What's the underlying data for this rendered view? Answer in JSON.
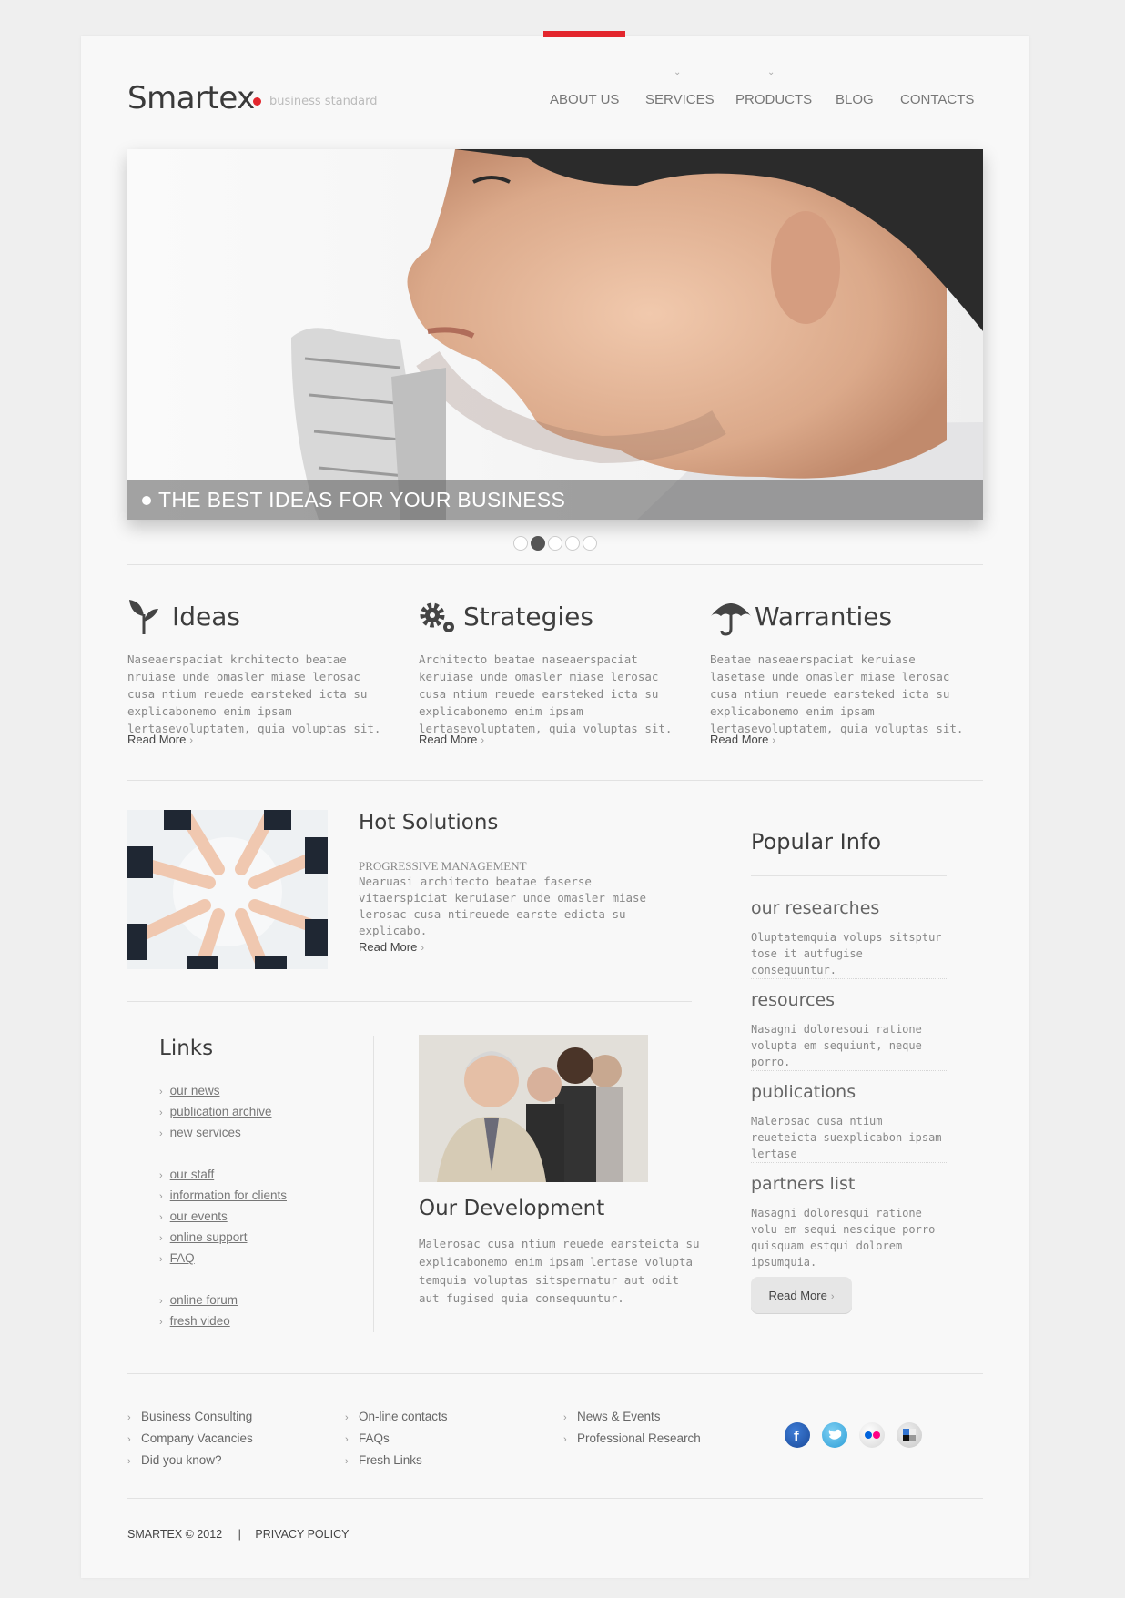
{
  "header": {
    "logo": "Smartex",
    "tagline": "business standard",
    "nav": [
      "ABOUT US",
      "SERVICES",
      "PRODUCTS",
      "BLOG",
      "CONTACTS"
    ]
  },
  "slider": {
    "caption": "THE BEST IDEAS FOR YOUR BUSINESS",
    "slides": 5,
    "active_slide": 2
  },
  "features": [
    {
      "icon": "plant-icon",
      "title": "Ideas",
      "text": "Naseaerspaciat krchitecto beatae nruiase unde omasler miase lerosac cusa ntium reuede earsteked icta su explicabonemo enim ipsam lertasevoluptatem, quia voluptas sit.",
      "link": "Read More"
    },
    {
      "icon": "gears-icon",
      "title": "Strategies",
      "text": "Architecto beatae naseaerspaciat keruiase unde omasler miase lerosac cusa ntium reuede earsteked icta su explicabonemo enim ipsam lertasevoluptatem, quia voluptas sit.",
      "link": "Read More"
    },
    {
      "icon": "umbrella-icon",
      "title": "Warranties",
      "text": "Beatae naseaerspaciat keruiase lasetase unde omasler miase lerosac cusa ntium reuede earsteked icta su explicabonemo enim ipsam lertasevoluptatem, quia voluptas sit.",
      "link": "Read More"
    }
  ],
  "hot": {
    "title": "Hot Solutions",
    "subtitle": "PROGRESSIVE MANAGEMENT",
    "text": "Nearuasi architecto beatae faserse vitaerspiciat keruiaser unde omasler miase lerosac cusa ntireuede earste edicta su explicabo.",
    "link": "Read More"
  },
  "links": {
    "title": "Links",
    "items": [
      "our news",
      "publication archive",
      "new services",
      "our staff",
      "information for clients",
      "our events",
      "online support",
      "FAQ",
      "online forum",
      "fresh video"
    ]
  },
  "dev": {
    "title": "Our Development",
    "text": "Malerosac cusa ntium reuede earsteicta su explicabonemo enim ipsam lertase volupta temquia voluptas sitspernatur aut odit aut fugised quia consequuntur."
  },
  "popular": {
    "title": "Popular Info",
    "items": [
      {
        "head": "our researches",
        "text": "Oluptatemquia volups sitsptur tose it autfugise consequuntur."
      },
      {
        "head": "resources",
        "text": "Nasagni doloresoui ratione volupta em sequiunt, neque porro."
      },
      {
        "head": "publications",
        "text": "Malerosac cusa ntium reueteicta suexplicabon ipsam lertase"
      },
      {
        "head": "partners list",
        "text": "Nasagni doloresqui ratione volu em sequi nescique porro quisquam estqui dolorem ipsumquia."
      }
    ],
    "button": "Read More"
  },
  "footer": {
    "col1": [
      "Business Consulting",
      "Company Vacancies",
      "Did you know?"
    ],
    "col2": [
      "On-line contacts",
      "FAQs",
      "Fresh Links"
    ],
    "col3": [
      "News & Events",
      "Professional Research"
    ],
    "social": [
      "facebook-icon",
      "twitter-icon",
      "flickr-icon",
      "delicious-icon"
    ],
    "copyright": "SMARTEX © 2012",
    "separator": "|",
    "privacy": "PRIVACY POLICY"
  },
  "colors": {
    "accent": "#e3262d",
    "text": "#555555",
    "background": "#f8f8f8"
  }
}
